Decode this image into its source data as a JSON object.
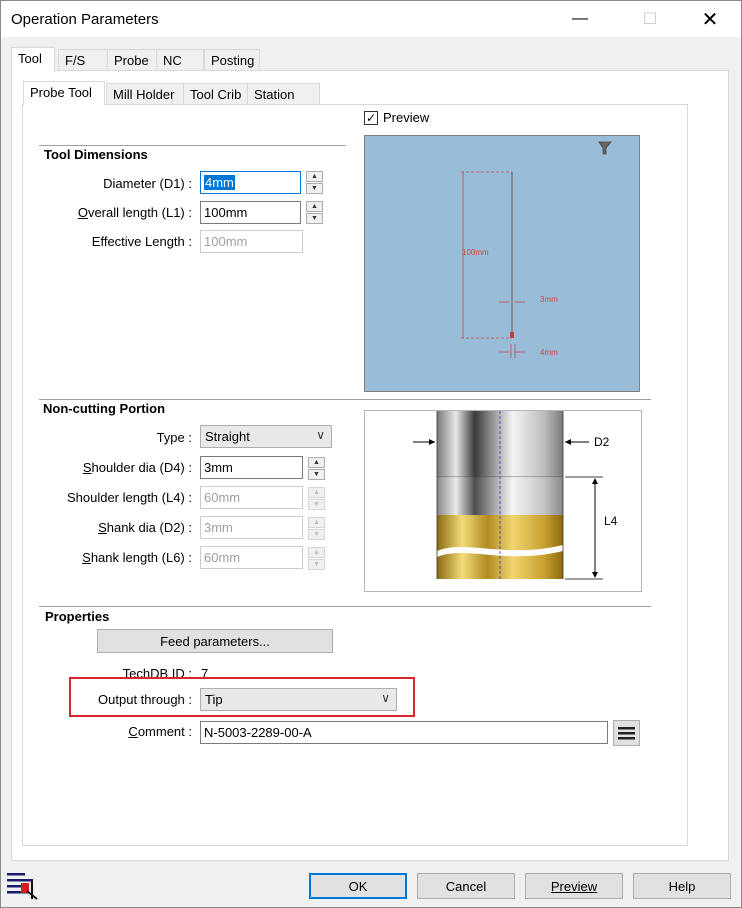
{
  "window": {
    "title": "Operation Parameters"
  },
  "main_tabs": [
    {
      "label": "Tool"
    },
    {
      "label": "F/S"
    },
    {
      "label": "Probe"
    },
    {
      "label": "NC"
    },
    {
      "label": "Posting"
    }
  ],
  "sub_tabs": [
    {
      "label": "Probe Tool"
    },
    {
      "label": "Mill Holder"
    },
    {
      "label": "Tool Crib"
    },
    {
      "label": "Station"
    }
  ],
  "preview": {
    "label": "Preview",
    "checked": true,
    "dim_length": "100mm",
    "dim_shoulder": "3mm",
    "dim_tip": "4mm"
  },
  "tool_dimensions": {
    "title": "Tool Dimensions",
    "diameter": {
      "label_pre": "Diameter (D1) :",
      "value": "4mm"
    },
    "overall_length": {
      "label_u": "O",
      "label_rest": "verall length (L1) :",
      "value": "100mm"
    },
    "effective_length": {
      "label": "Effective Length :",
      "value": "100mm"
    }
  },
  "non_cutting": {
    "title": "Non-cutting Portion",
    "type": {
      "label": "Type :",
      "value": "Straight"
    },
    "shoulder_dia": {
      "label_u": "S",
      "label_rest": "houlder dia (D4) :",
      "value": "3mm"
    },
    "shoulder_length": {
      "label": "Shoulder length (L4) :",
      "value": "60mm"
    },
    "shank_dia": {
      "label_u": "S",
      "label_rest": "hank dia (D2) :",
      "value": "3mm"
    },
    "shank_length": {
      "label_u": "S",
      "label_rest": "hank length (L6) :",
      "value": "60mm"
    },
    "diagram_d2": "D2",
    "diagram_l4": "L4"
  },
  "properties": {
    "title": "Properties",
    "feed_button": "Feed parameters...",
    "techdb": {
      "label": "TechDB ID :",
      "value": "7"
    },
    "output_through": {
      "label": "Output through :",
      "value": "Tip"
    },
    "comment": {
      "label_u": "C",
      "label_rest": "omment :",
      "value": "N-5003-2289-00-A"
    }
  },
  "buttons": {
    "ok": "OK",
    "cancel": "Cancel",
    "preview": "Preview",
    "help": "Help"
  },
  "colors": {
    "highlight_box": "#d9262c",
    "accent": "#0078d7",
    "preview_bg": "#99bcd8",
    "dim_color": "#e05050"
  }
}
